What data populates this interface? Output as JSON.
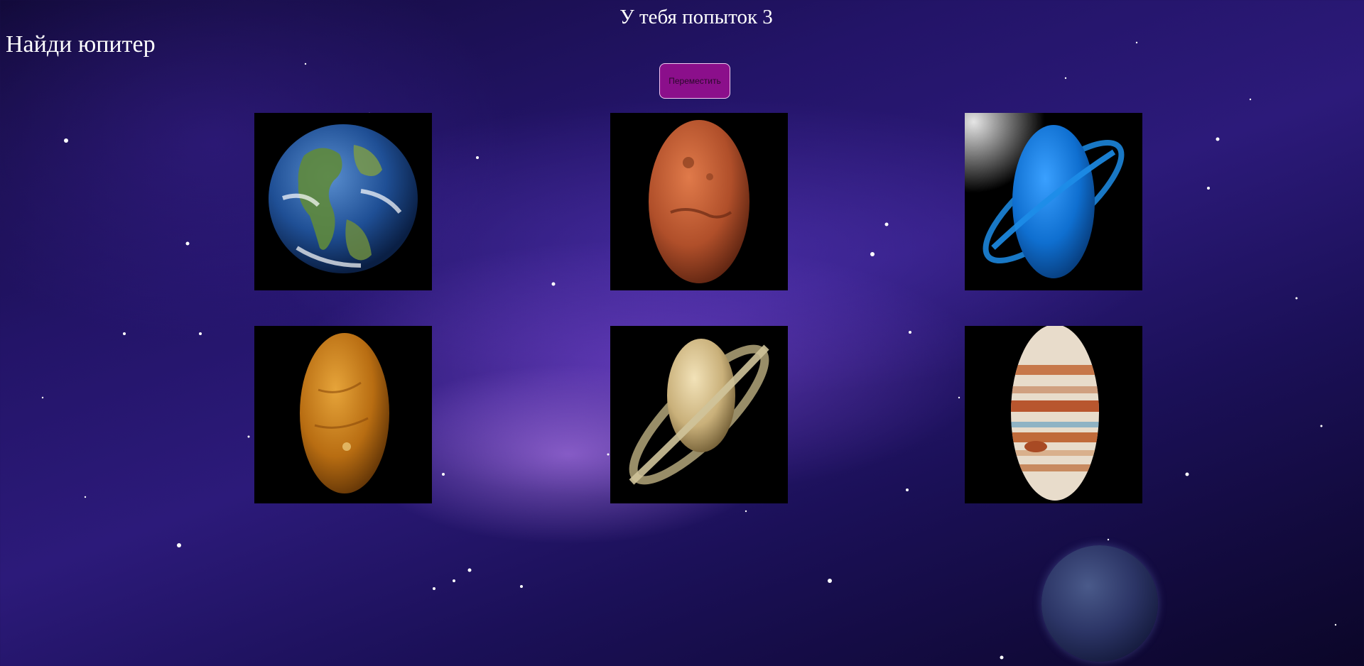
{
  "header": {
    "attempts_text": "У тебя попыток 3",
    "task_text": "Найди юпитер"
  },
  "controls": {
    "move_button_label": "Переместить",
    "move_button_color": "#8b0f8b"
  },
  "planets": [
    {
      "name": "earth-icon"
    },
    {
      "name": "mars-icon"
    },
    {
      "name": "neptune-icon"
    },
    {
      "name": "venus-icon"
    },
    {
      "name": "saturn-icon"
    },
    {
      "name": "jupiter-icon"
    }
  ],
  "colors": {
    "background_deep": "#120a3a",
    "background_mid": "#2c1a7a",
    "nebula_glow": "#c88cff",
    "text": "#ffffff"
  }
}
